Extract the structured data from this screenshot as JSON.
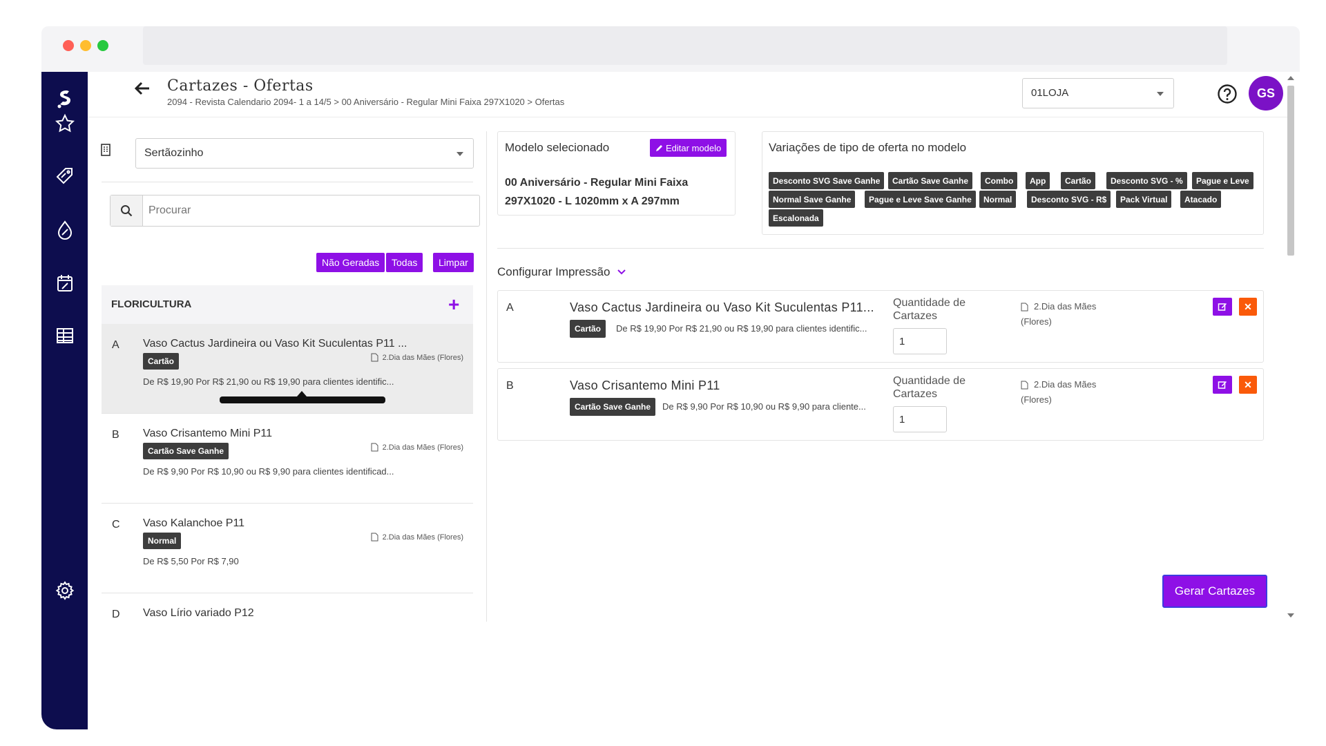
{
  "header": {
    "title": "Cartazes - Ofertas",
    "breadcrumb": "2094 - Revista Calendario 2094- 1 a 14/5 > 00 Aniversário - Regular Mini Faixa 297X1020 > Ofertas",
    "store_select": "01LOJA",
    "avatar_initials": "GS"
  },
  "sidebar": {
    "items": [
      {
        "icon": "logo-icon"
      },
      {
        "icon": "star-icon"
      },
      {
        "icon": "tag-discount-icon"
      },
      {
        "icon": "drop-percent-icon"
      },
      {
        "icon": "calendar-percent-icon"
      },
      {
        "icon": "table-grid-icon"
      },
      {
        "icon": "gear-icon"
      }
    ]
  },
  "left_panel": {
    "city_select": "Sertãozinho",
    "search_placeholder": "Procurar",
    "filters": [
      "Não Geradas",
      "Todas",
      "Limpar"
    ],
    "category": "FLORICULTURA",
    "offers": [
      {
        "letter": "A",
        "name": "Vaso Cactus Jardineira ou Vaso Kit Suculentas P11 ...",
        "tag": "Cartão",
        "ref": "2.Dia das Mães (Flores)",
        "price": "De R$ 19,90 Por R$ 21,90 ou R$ 19,90 para clientes identific..."
      },
      {
        "letter": "B",
        "name": "Vaso Crisantemo Mini P11",
        "tag": "Cartão Save Ganhe",
        "ref": "2.Dia das Mães (Flores)",
        "price": "De R$ 9,90 Por R$ 10,90 ou R$ 9,90 para clientes identificad..."
      },
      {
        "letter": "C",
        "name": "Vaso Kalanchoe P11",
        "tag": "Normal",
        "ref": "2.Dia das Mães (Flores)",
        "price": "De R$ 5,50 Por R$ 7,90"
      },
      {
        "letter": "D",
        "name": "Vaso Lírio variado P12"
      }
    ]
  },
  "model": {
    "label": "Modelo selecionado",
    "edit_label": "Editar modelo",
    "name": "00 Aniversário - Regular Mini Faixa 297X1020 - L 1020mm x A 297mm"
  },
  "variations": {
    "label": "Variações de tipo de oferta no modelo",
    "tags": [
      "Desconto SVG Save Ganhe",
      "Cartão Save Ganhe",
      "Combo",
      "App",
      "Cartão",
      "Desconto SVG - %",
      "Pague e Leve",
      "Normal Save Ganhe",
      "Pague e Leve Save Ganhe",
      "Normal",
      "Desconto SVG - R$",
      "Pack Virtual",
      "Atacado",
      "Escalonada"
    ]
  },
  "config": {
    "title": "Configurar Impressão",
    "qty_label": "Quantidade de Cartazes",
    "items": [
      {
        "letter": "A",
        "name": "Vaso Cactus Jardineira ou Vaso Kit Suculentas P11...",
        "tag": "Cartão",
        "price": "De R$ 19,90 Por R$ 21,90 ou R$ 19,90 para clientes identific...",
        "qty": "1",
        "ref_line1": "2.Dia das Mães",
        "ref_line2": "(Flores)"
      },
      {
        "letter": "B",
        "name": "Vaso Crisantemo Mini P11",
        "tag": "Cartão Save Ganhe",
        "price": "De R$ 9,90 Por R$ 10,90 ou R$ 9,90 para cliente...",
        "qty": "1",
        "ref_line1": "2.Dia das Mães",
        "ref_line2": "(Flores)"
      }
    ],
    "generate_label": "Gerar Cartazes"
  },
  "colors": {
    "accent": "#8e10e6",
    "sidebar": "#0d0d4e",
    "tag": "#3d3d3d",
    "delete": "#fa5a0a"
  }
}
